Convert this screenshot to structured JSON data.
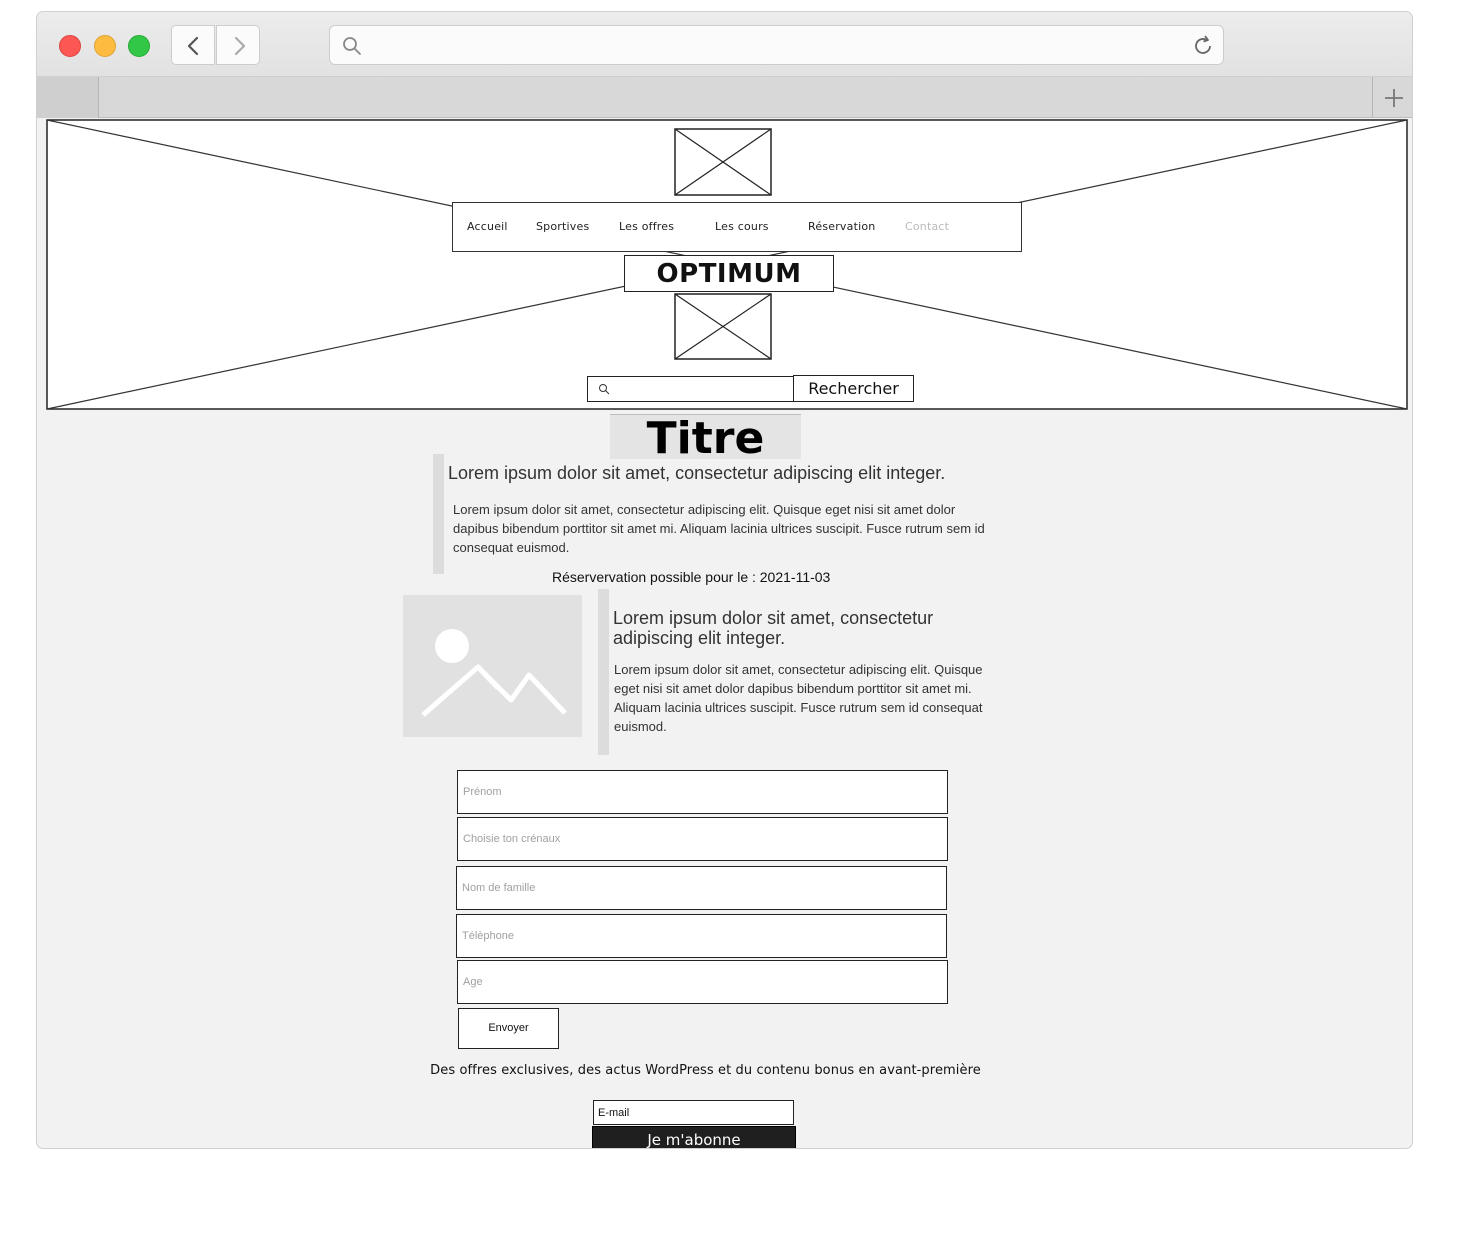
{
  "nav": {
    "items": [
      "Accueil",
      "Sportives",
      "Les offres",
      "Les cours",
      "Réservation",
      "Contact"
    ]
  },
  "brand": "OPTIMUM",
  "search": {
    "button_label": "Rechercher"
  },
  "main": {
    "title": "Titre",
    "block1": {
      "heading": "Lorem ipsum dolor sit amet, consectetur adipiscing elit integer.",
      "body": "Lorem ipsum dolor sit amet, consectetur adipiscing elit. Quisque eget nisi sit amet dolor dapibus bibendum porttitor sit amet mi. Aliquam lacinia ultrices suscipit. Fusce rutrum sem id consequat euismod."
    },
    "reservation": "Réservervation possible pour le :  2021-11-03",
    "block2": {
      "heading": "Lorem ipsum dolor sit amet, consectetur adipiscing elit integer.",
      "body": "Lorem ipsum dolor sit amet, consectetur adipiscing elit. Quisque eget nisi sit amet dolor dapibus bibendum porttitor sit amet mi. Aliquam lacinia ultrices suscipit. Fusce rutrum sem id consequat euismod."
    }
  },
  "form": {
    "firstname_placeholder": "Prénom",
    "slot_placeholder": "Choisie ton crénaux",
    "lastname_placeholder": "Nom de famille",
    "phone_placeholder": "Télèphone",
    "age_placeholder": "Age",
    "submit_label": "Envoyer"
  },
  "newsletter": {
    "text": "Des offres exclusives, des actus WordPress et du contenu bonus en avant-première",
    "email_placeholder": "E-mail",
    "subscribe_label": "Je m'abonne"
  },
  "colors": {
    "page_bg": "#f2f2f2",
    "nav_disabled": "#bbbbbb",
    "subscribe_bg": "#1f1f1f"
  }
}
